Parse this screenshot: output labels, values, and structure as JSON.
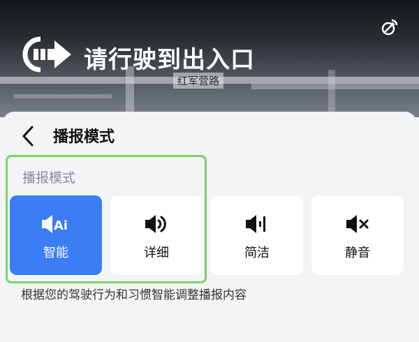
{
  "nav": {
    "instruction": "请行驶到出入口",
    "road_name": "红军营路"
  },
  "panel": {
    "title": "播报模式",
    "section_label": "播报模式",
    "modes": [
      {
        "label": "智能",
        "icon": "speaker-ai-icon",
        "selected": true
      },
      {
        "label": "详细",
        "icon": "speaker-full-icon",
        "selected": false
      },
      {
        "label": "简洁",
        "icon": "speaker-concise-icon",
        "selected": false
      },
      {
        "label": "静音",
        "icon": "speaker-mute-icon",
        "selected": false
      }
    ],
    "description": "根据您的驾驶行为和习惯智能调整播报内容"
  },
  "colors": {
    "accent": "#3b7df5",
    "highlight": "#7ad36b",
    "panel_bg": "#f3f4f6",
    "card_bg": "#ffffff"
  }
}
